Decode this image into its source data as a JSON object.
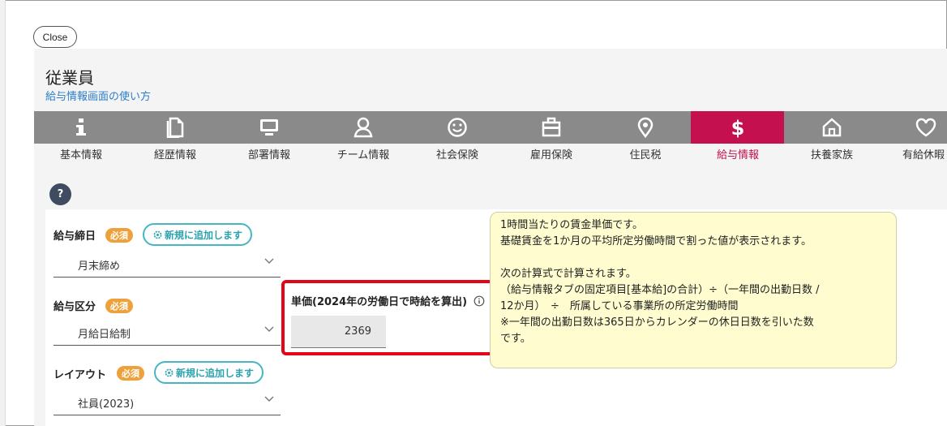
{
  "close_label": "Close",
  "header": {
    "title": "従業員",
    "help_link": "給与情報画面の使い方"
  },
  "tabs": [
    {
      "label": "基本情報",
      "icon": "info-icon"
    },
    {
      "label": "経歴情報",
      "icon": "document-icon"
    },
    {
      "label": "部署情報",
      "icon": "monitor-icon"
    },
    {
      "label": "チーム情報",
      "icon": "person-icon"
    },
    {
      "label": "社会保険",
      "icon": "smile-icon"
    },
    {
      "label": "雇用保険",
      "icon": "briefcase-icon"
    },
    {
      "label": "住民税",
      "icon": "location-pin-icon"
    },
    {
      "label": "給与情報",
      "icon": "dollar-icon",
      "active": true
    },
    {
      "label": "扶養家族",
      "icon": "home-icon"
    },
    {
      "label": "有給休暇",
      "icon": "heart-icon"
    }
  ],
  "help_button": "?",
  "form": {
    "required_badge": "必須",
    "add_new_label": "新規に追加します",
    "closing_day": {
      "label": "給与締日",
      "value": "月末締め"
    },
    "pay_type": {
      "label": "給与区分",
      "value": "月給日給制"
    },
    "layout": {
      "label": "レイアウト",
      "value": "社員(2023)"
    },
    "unit_price": {
      "label": "単価(2024年の労働日で時給を算出)",
      "value": "2369"
    }
  },
  "tooltip": {
    "line1": "1時間当たりの賃金単価です。",
    "line2": "基礎賃金を1か月の平均所定労働時間で割った値が表示されます。",
    "line3": "次の計算式で計算されます。",
    "line4": "（給与情報タブの固定項目[基本給]の合計）÷（一年間の出勤日数 /",
    "line5": "12か月）　÷　所属している事業所の所定労働時間",
    "line6": "※一年間の出勤日数は365日からカレンダーの休日日数を引いた数",
    "line7": "です。"
  },
  "colors": {
    "active_tab": "#c5104f",
    "tab_bar": "#8a8a8a",
    "required_badge": "#eea13b",
    "add_new": "#46b7c2",
    "highlight": "#e3061b",
    "tooltip_bg": "#fffdcf"
  }
}
